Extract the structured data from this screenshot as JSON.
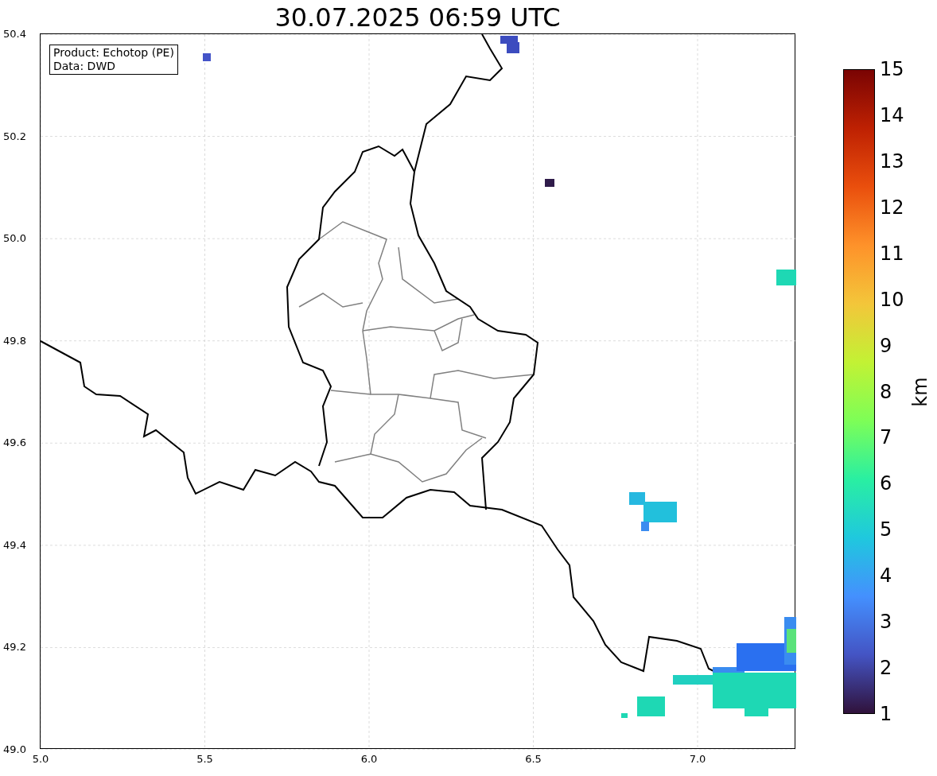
{
  "title": "30.07.2025 06:59 UTC",
  "info_box": [
    "Product: Echotop (PE)",
    "Data: DWD"
  ],
  "y_ticks": [
    "50.4",
    "50.2",
    "50.0",
    "49.8",
    "49.6",
    "49.4",
    "49.2",
    "49.0"
  ],
  "x_ticks": [
    "5.0",
    "5.5",
    "6.0",
    "6.5",
    "7.0"
  ],
  "colorbar": {
    "label": "km",
    "ticks": [
      "15",
      "14",
      "13",
      "12",
      "11",
      "10",
      "9",
      "8",
      "7",
      "6",
      "5",
      "4",
      "3",
      "2",
      "1"
    ]
  }
}
